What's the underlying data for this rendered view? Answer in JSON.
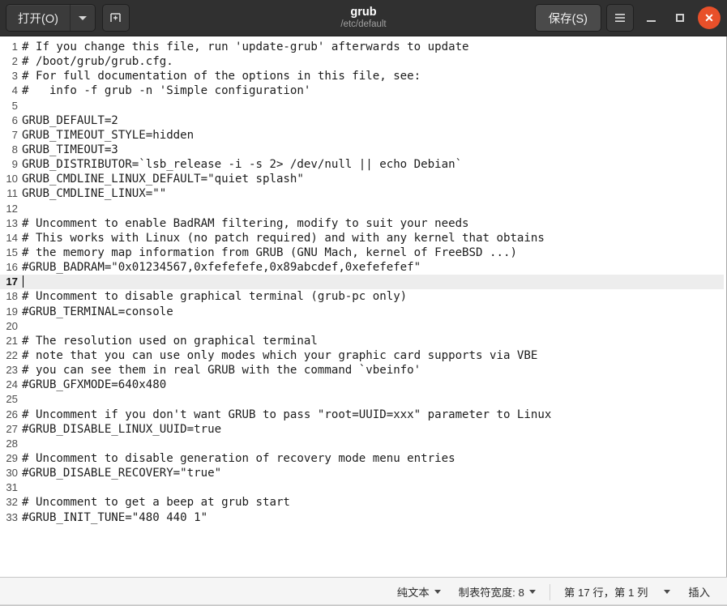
{
  "titlebar": {
    "open_button": "打开(O)",
    "open_dropdown_icon": "chevron-down-icon",
    "new_tab_icon": "new-document-icon",
    "title": "grub",
    "subtitle": "/etc/default",
    "save_button": "保存(S)",
    "menu_icon": "hamburger-menu-icon",
    "minimize_icon": "minimize-icon",
    "maximize_icon": "maximize-icon",
    "close_icon": "close-icon",
    "close_glyph": "✕",
    "bg_color": "#303030",
    "close_color": "#e8502a"
  },
  "editor": {
    "current_line": 17,
    "lines": [
      {
        "n": "1",
        "text": "# If you change this file, run 'update-grub' afterwards to update"
      },
      {
        "n": "2",
        "text": "# /boot/grub/grub.cfg."
      },
      {
        "n": "3",
        "text": "# For full documentation of the options in this file, see:"
      },
      {
        "n": "4",
        "text": "#   info -f grub -n 'Simple configuration'"
      },
      {
        "n": "5",
        "text": ""
      },
      {
        "n": "6",
        "text": "GRUB_DEFAULT=2"
      },
      {
        "n": "7",
        "text": "GRUB_TIMEOUT_STYLE=hidden"
      },
      {
        "n": "8",
        "text": "GRUB_TIMEOUT=3"
      },
      {
        "n": "9",
        "text": "GRUB_DISTRIBUTOR=`lsb_release -i -s 2> /dev/null || echo Debian`"
      },
      {
        "n": "10",
        "text": "GRUB_CMDLINE_LINUX_DEFAULT=\"quiet splash\""
      },
      {
        "n": "11",
        "text": "GRUB_CMDLINE_LINUX=\"\""
      },
      {
        "n": "12",
        "text": ""
      },
      {
        "n": "13",
        "text": "# Uncomment to enable BadRAM filtering, modify to suit your needs"
      },
      {
        "n": "14",
        "text": "# This works with Linux (no patch required) and with any kernel that obtains"
      },
      {
        "n": "15",
        "text": "# the memory map information from GRUB (GNU Mach, kernel of FreeBSD ...)"
      },
      {
        "n": "16",
        "text": "#GRUB_BADRAM=\"0x01234567,0xfefefefe,0x89abcdef,0xefefefef\""
      },
      {
        "n": "17",
        "text": ""
      },
      {
        "n": "18",
        "text": "# Uncomment to disable graphical terminal (grub-pc only)"
      },
      {
        "n": "19",
        "text": "#GRUB_TERMINAL=console"
      },
      {
        "n": "20",
        "text": ""
      },
      {
        "n": "21",
        "text": "# The resolution used on graphical terminal"
      },
      {
        "n": "22",
        "text": "# note that you can use only modes which your graphic card supports via VBE"
      },
      {
        "n": "23",
        "text": "# you can see them in real GRUB with the command `vbeinfo'"
      },
      {
        "n": "24",
        "text": "#GRUB_GFXMODE=640x480"
      },
      {
        "n": "25",
        "text": ""
      },
      {
        "n": "26",
        "text": "# Uncomment if you don't want GRUB to pass \"root=UUID=xxx\" parameter to Linux"
      },
      {
        "n": "27",
        "text": "#GRUB_DISABLE_LINUX_UUID=true"
      },
      {
        "n": "28",
        "text": ""
      },
      {
        "n": "29",
        "text": "# Uncomment to disable generation of recovery mode menu entries"
      },
      {
        "n": "30",
        "text": "#GRUB_DISABLE_RECOVERY=\"true\""
      },
      {
        "n": "31",
        "text": ""
      },
      {
        "n": "32",
        "text": "# Uncomment to get a beep at grub start"
      },
      {
        "n": "33",
        "text": "#GRUB_INIT_TUNE=\"480 440 1\""
      }
    ]
  },
  "statusbar": {
    "language": "纯文本",
    "tab_width": "制表符宽度: 8",
    "position": "第 17 行，第 1 列",
    "insert_mode": "插入"
  }
}
